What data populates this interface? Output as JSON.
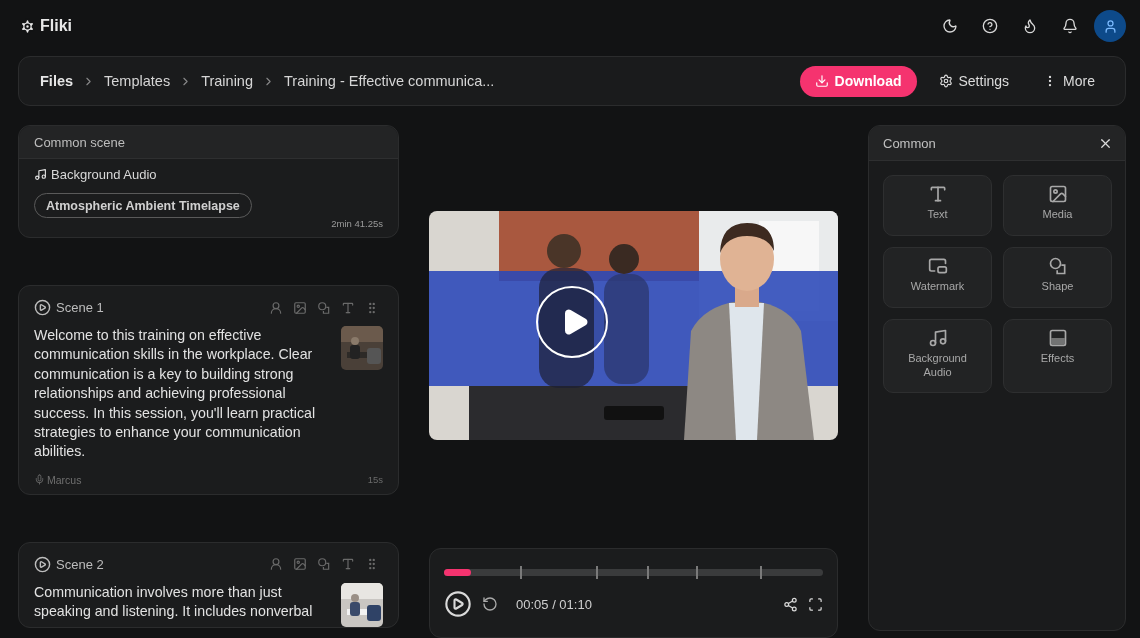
{
  "app": {
    "name": "Fliki"
  },
  "breadcrumbs": [
    {
      "label": "Files"
    },
    {
      "label": "Templates"
    },
    {
      "label": "Training"
    },
    {
      "label": "Training - Effective communica..."
    }
  ],
  "actions": [
    {
      "label": "Download",
      "kind": "primary"
    },
    {
      "label": "Settings",
      "kind": "settings"
    },
    {
      "label": "More",
      "kind": "more"
    }
  ],
  "common_scene": {
    "title": "Common scene",
    "audio_label": "Background Audio",
    "track": "Atmospheric Ambient Timelapse",
    "duration": "2min 41.25s"
  },
  "scenes": [
    {
      "title": "Scene 1",
      "text": "Welcome to this training on effective communication skills in the workplace. Clear communication is a key to building strong relationships and achieving professional success. In this session, you'll learn practical strategies to enhance your communication abilities.",
      "voice": "Marcus",
      "duration": "15s"
    },
    {
      "title": "Scene 2",
      "text": "Communication involves more than just speaking and listening. It includes nonverbal"
    }
  ],
  "player": {
    "level": 0.07,
    "time": "00:05 / 01:10"
  },
  "panel": {
    "title": "Common",
    "items": [
      {
        "label": "Text",
        "kind": "text"
      },
      {
        "label": "Media",
        "kind": "media"
      },
      {
        "label": "Watermark",
        "kind": "watermark"
      },
      {
        "label": "Shape",
        "kind": "shape"
      },
      {
        "label": "Background Audio",
        "kind": "audio"
      },
      {
        "label": "Effects",
        "kind": "effects"
      }
    ]
  }
}
